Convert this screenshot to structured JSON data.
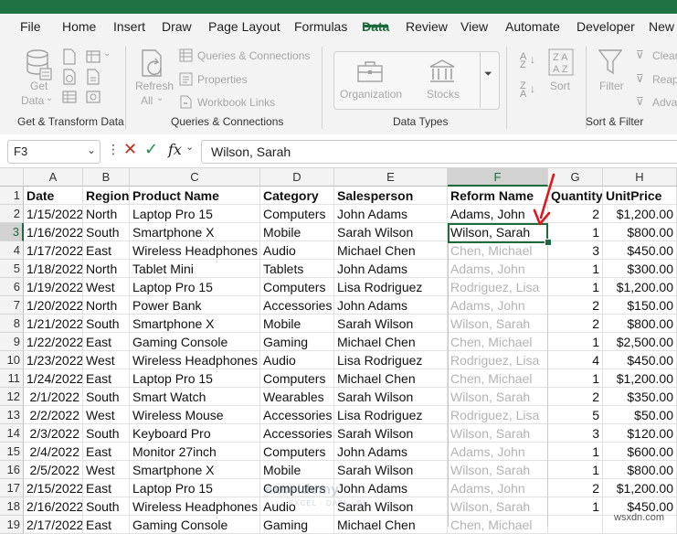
{
  "ribbon_tabs": [
    "File",
    "Home",
    "Insert",
    "Draw",
    "Page Layout",
    "Formulas",
    "Data",
    "Review",
    "View",
    "Automate",
    "Developer",
    "New"
  ],
  "active_tab": "Data",
  "ribbon": {
    "get_data": "Get\nData",
    "get_data_l1": "Get",
    "get_data_l2": "Data",
    "refresh_l1": "Refresh",
    "refresh_l2": "All",
    "queries_connections": "Queries & Connections",
    "properties": "Properties",
    "workbook_links": "Workbook Links",
    "organization": "Organization",
    "stocks": "Stocks",
    "sort": "Sort",
    "filter": "Filter",
    "clear": "Clear",
    "reapply": "Reap",
    "advanced": "Adva",
    "groups": {
      "get_transform": "Get & Transform Data",
      "queries": "Queries & Connections",
      "data_types": "Data Types",
      "sort_filter": "Sort & Filter"
    }
  },
  "formula_bar": {
    "name_box": "F3",
    "fx_label": "fx",
    "content": "Wilson, Sarah"
  },
  "columns": [
    "A",
    "B",
    "C",
    "D",
    "E",
    "F",
    "G",
    "H"
  ],
  "selected_column": "F",
  "selected_row": "3",
  "rows": [
    {
      "n": "1",
      "cells": [
        "Date",
        "Region",
        "Product Name",
        "Category",
        "Salesperson",
        "Reform Name",
        "Quantity",
        "UnitPrice"
      ]
    },
    {
      "n": "2",
      "cells": [
        "1/15/2022",
        "North",
        "Laptop Pro 15",
        "Computers",
        "John Adams",
        "Adams, John",
        "2",
        "$1,200.00"
      ]
    },
    {
      "n": "3",
      "cells": [
        "1/16/2022",
        "South",
        "Smartphone X",
        "Mobile",
        "Sarah Wilson",
        "Wilson, Sarah",
        "1",
        "$800.00"
      ]
    },
    {
      "n": "4",
      "cells": [
        "1/17/2022",
        "East",
        "Wireless Headphones",
        "Audio",
        "Michael Chen",
        "Chen, Michael",
        "3",
        "$450.00"
      ]
    },
    {
      "n": "5",
      "cells": [
        "1/18/2022",
        "North",
        "Tablet Mini",
        "Tablets",
        "John Adams",
        "Adams, John",
        "1",
        "$300.00"
      ]
    },
    {
      "n": "6",
      "cells": [
        "1/19/2022",
        "West",
        "Laptop Pro 15",
        "Computers",
        "Lisa Rodriguez",
        "Rodriguez, Lisa",
        "1",
        "$1,200.00"
      ]
    },
    {
      "n": "7",
      "cells": [
        "1/20/2022",
        "North",
        "Power Bank",
        "Accessories",
        "John Adams",
        "Adams, John",
        "2",
        "$150.00"
      ]
    },
    {
      "n": "8",
      "cells": [
        "1/21/2022",
        "South",
        "Smartphone X",
        "Mobile",
        "Sarah Wilson",
        "Wilson, Sarah",
        "2",
        "$800.00"
      ]
    },
    {
      "n": "9",
      "cells": [
        "1/22/2022",
        "East",
        "Gaming Console",
        "Gaming",
        "Michael Chen",
        "Chen, Michael",
        "1",
        "$2,500.00"
      ]
    },
    {
      "n": "10",
      "cells": [
        "1/23/2022",
        "West",
        "Wireless Headphones",
        "Audio",
        "Lisa Rodriguez",
        "Rodriguez, Lisa",
        "4",
        "$450.00"
      ]
    },
    {
      "n": "11",
      "cells": [
        "1/24/2022",
        "East",
        "Laptop Pro 15",
        "Computers",
        "Michael Chen",
        "Chen, Michael",
        "1",
        "$1,200.00"
      ]
    },
    {
      "n": "12",
      "cells": [
        "2/1/2022",
        "South",
        "Smart Watch",
        "Wearables",
        "Sarah Wilson",
        "Wilson, Sarah",
        "2",
        "$350.00"
      ]
    },
    {
      "n": "13",
      "cells": [
        "2/2/2022",
        "West",
        "Wireless Mouse",
        "Accessories",
        "Lisa Rodriguez",
        "Rodriguez, Lisa",
        "5",
        "$50.00"
      ]
    },
    {
      "n": "14",
      "cells": [
        "2/3/2022",
        "South",
        "Keyboard Pro",
        "Accessories",
        "Sarah Wilson",
        "Wilson, Sarah",
        "3",
        "$120.00"
      ]
    },
    {
      "n": "15",
      "cells": [
        "2/4/2022",
        "East",
        "Monitor 27inch",
        "Computers",
        "John Adams",
        "Adams, John",
        "1",
        "$600.00"
      ]
    },
    {
      "n": "16",
      "cells": [
        "2/5/2022",
        "West",
        "Smartphone X",
        "Mobile",
        "Sarah Wilson",
        "Wilson, Sarah",
        "1",
        "$800.00"
      ]
    },
    {
      "n": "17",
      "cells": [
        "2/15/2022",
        "East",
        "Laptop Pro 15",
        "Computers",
        "John Adams",
        "Adams, John",
        "2",
        "$1,200.00"
      ]
    },
    {
      "n": "18",
      "cells": [
        "2/16/2022",
        "South",
        "Wireless Headphones",
        "Audio",
        "Sarah Wilson",
        "Wilson, Sarah",
        "1",
        "$450.00"
      ]
    },
    {
      "n": "19",
      "cells": [
        "2/17/2022",
        "East",
        "Gaming Console",
        "Gaming",
        "Michael Chen",
        "Chen, Michael",
        "",
        ""
      ]
    }
  ],
  "watermark": "exceldemy",
  "watermark_sub": "EXCEL · DATA · BI",
  "site_tag": "wsxdn.com",
  "colors": {
    "accent": "#1d6b3c",
    "arrow": "#e0161e",
    "ghost_text": "#b3b3b3"
  }
}
